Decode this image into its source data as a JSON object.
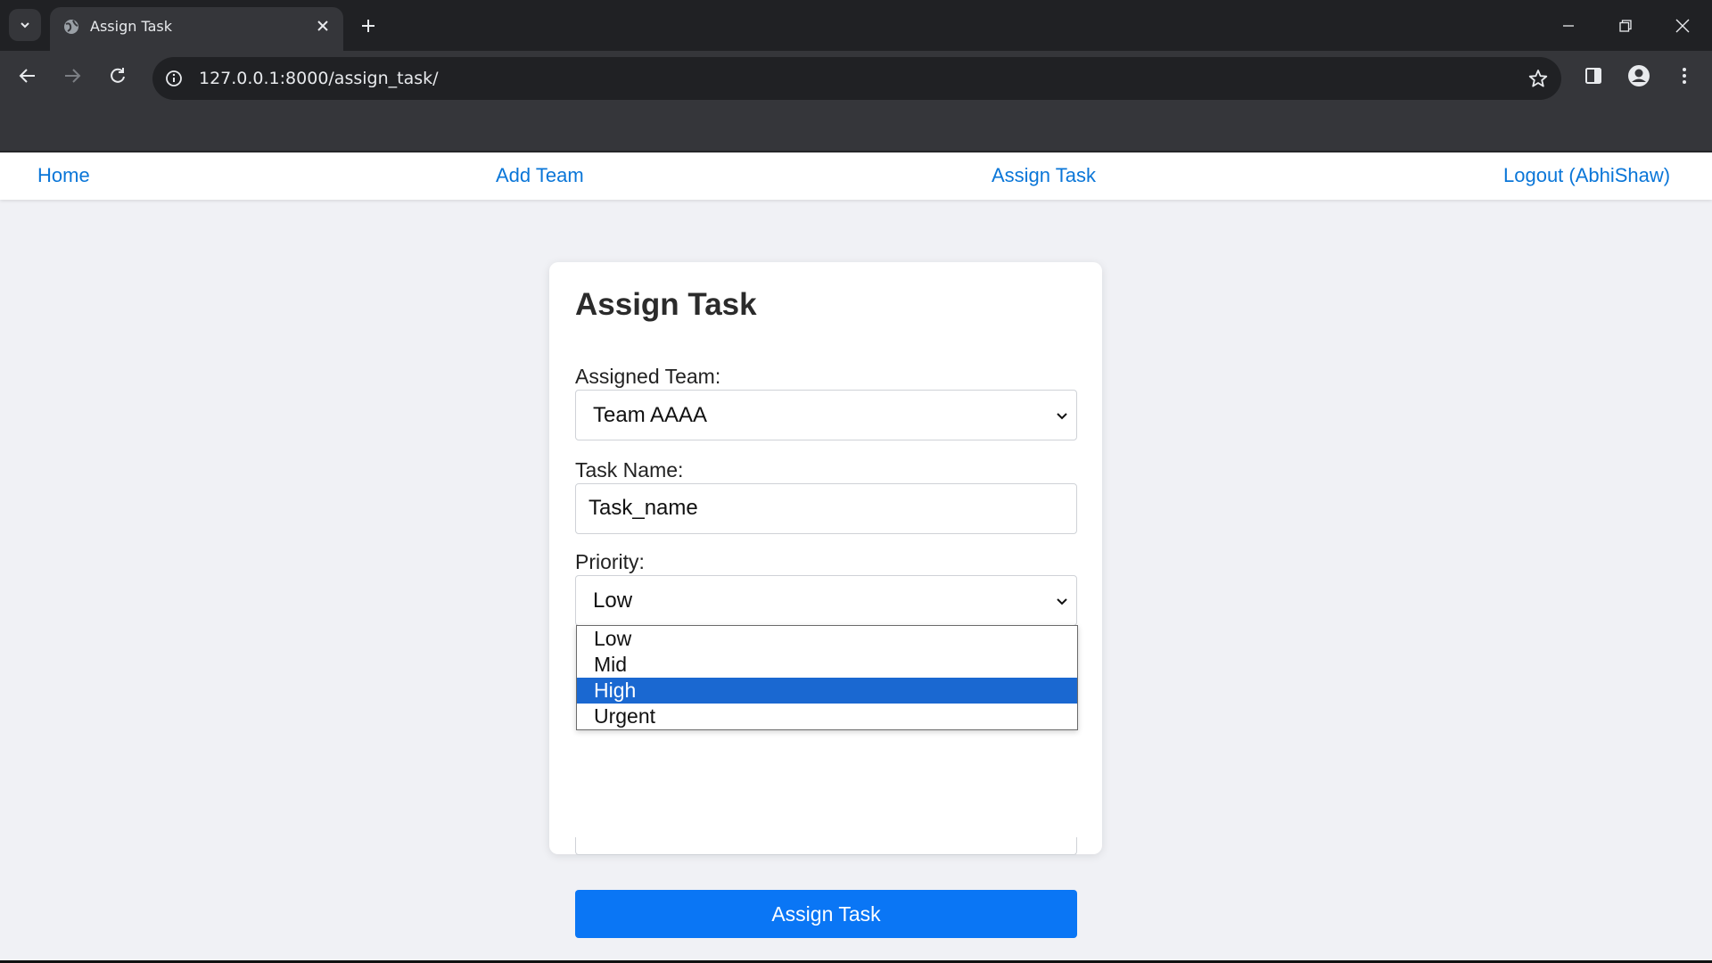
{
  "browser": {
    "tab_title": "Assign Task",
    "url": "127.0.0.1:8000/assign_task/"
  },
  "nav": {
    "home": "Home",
    "add_team": "Add Team",
    "assign_task": "Assign Task",
    "logout": "Logout (AbhiShaw)"
  },
  "form": {
    "title": "Assign Task",
    "team_label": "Assigned Team:",
    "team_value": "Team AAAA",
    "task_label": "Task Name:",
    "task_value": "Task_name",
    "priority_label": "Priority:",
    "priority_value": "Low",
    "priority_options": [
      "Low",
      "Mid",
      "High",
      "Urgent"
    ],
    "highlighted_option": "High",
    "submit_label": "Assign Task"
  },
  "colors": {
    "link": "#0a76d8",
    "button": "#0a76f5",
    "highlight": "#1a68d1",
    "page_bg": "#f0f1f5"
  },
  "icons": [
    "chevron-down-icon",
    "globe-icon",
    "close-icon",
    "plus-icon",
    "minimize-icon",
    "restore-icon",
    "back-icon",
    "forward-icon",
    "reload-icon",
    "info-icon",
    "star-icon",
    "side-panel-icon",
    "profile-icon",
    "more-icon"
  ]
}
